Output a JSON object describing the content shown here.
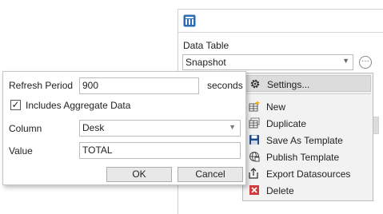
{
  "panel": {
    "data_table_label": "Data Table",
    "data_table_value": "Snapshot",
    "more_button": "···"
  },
  "menu": {
    "items": [
      {
        "label": "Settings...",
        "icon": "gear-icon"
      },
      {
        "label": "New",
        "icon": "new-table-icon"
      },
      {
        "label": "Duplicate",
        "icon": "duplicate-table-icon"
      },
      {
        "label": "Save As Template",
        "icon": "floppy-disk-icon"
      },
      {
        "label": "Publish Template",
        "icon": "globe-publish-icon"
      },
      {
        "label": "Export Datasources",
        "icon": "export-icon"
      },
      {
        "label": "Delete",
        "icon": "delete-icon"
      }
    ]
  },
  "dialog": {
    "refresh_label": "Refresh Period",
    "refresh_value": "900",
    "refresh_unit": "seconds",
    "aggregate_label": "Includes Aggregate Data",
    "aggregate_checked": true,
    "column_label": "Column",
    "column_value": "Desk",
    "value_label": "Value",
    "value_value": "TOTAL",
    "ok_label": "OK",
    "cancel_label": "Cancel"
  },
  "colors": {
    "accent": "#2b6cb5",
    "delete_red": "#d23b3b"
  }
}
